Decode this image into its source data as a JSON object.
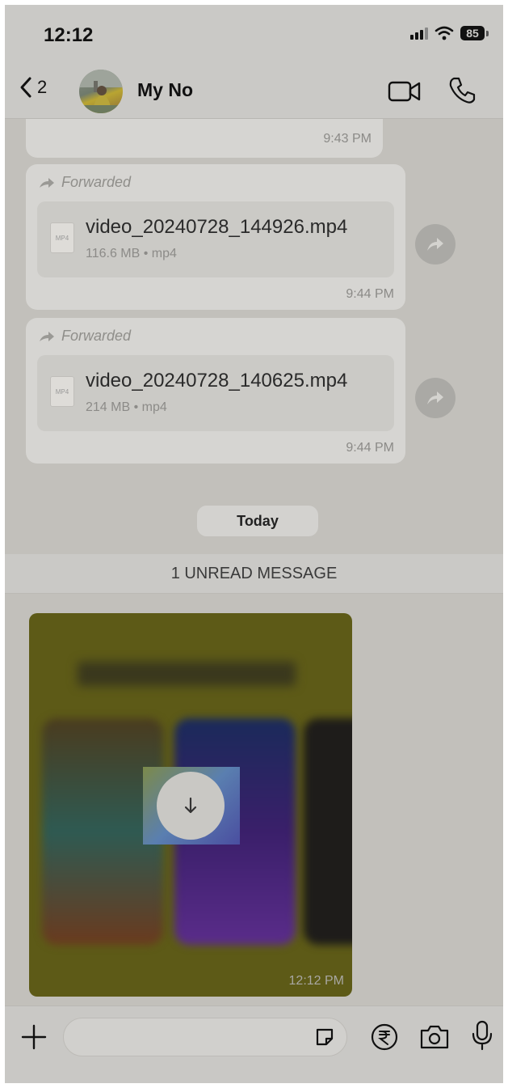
{
  "status_bar": {
    "time": "12:12",
    "battery": "85"
  },
  "header": {
    "back_count": "2",
    "contact_name": "My No"
  },
  "messages": [
    {
      "time": "9:43 PM"
    },
    {
      "forwarded_label": "Forwarded",
      "file_icon_label": "MP4",
      "file_name": "video_20240728_144926.mp4",
      "file_meta": "116.6 MB • mp4",
      "time": "9:44 PM"
    },
    {
      "forwarded_label": "Forwarded",
      "file_icon_label": "MP4",
      "file_name": "video_20240728_140625.mp4",
      "file_meta": "214 MB • mp4",
      "time": "9:44 PM"
    }
  ],
  "date_separator": "Today",
  "unread_banner": "1 UNREAD MESSAGE",
  "media_message": {
    "time": "12:12 PM"
  },
  "icons": [
    "chevron-left-icon",
    "video-call-icon",
    "phone-icon",
    "forward-arrow-icon",
    "share-icon",
    "download-icon",
    "plus-icon",
    "sticker-icon",
    "rupee-icon",
    "camera-icon",
    "microphone-icon"
  ],
  "colors": {
    "overlay_dim": "#c4c2bd",
    "bubble": "#d6d5d2"
  }
}
